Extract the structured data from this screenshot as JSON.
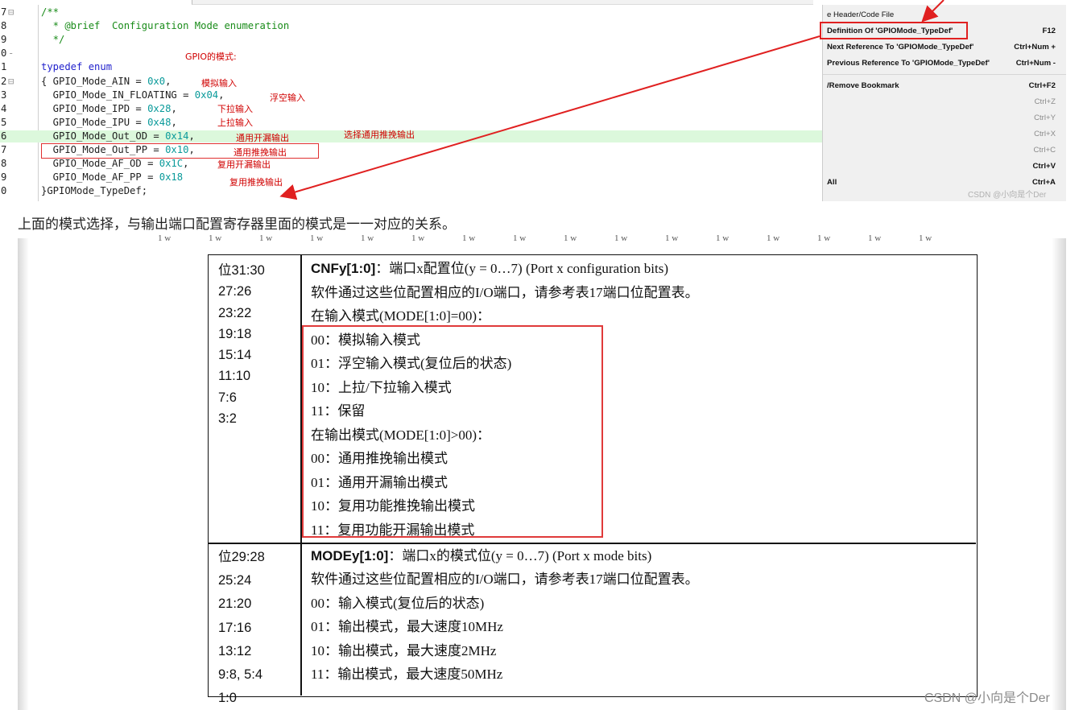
{
  "editor": {
    "lines": [
      {
        "n": "7",
        "fold": "⊟",
        "code": [
          [
            "cm",
            "/**"
          ]
        ]
      },
      {
        "n": "8",
        "fold": "",
        "code": [
          [
            "cm",
            "  * @brief  Configuration Mode enumeration"
          ]
        ]
      },
      {
        "n": "9",
        "fold": "",
        "code": [
          [
            "cm",
            "  */"
          ]
        ]
      },
      {
        "n": "0",
        "fold": "-",
        "code": [
          [
            "plain",
            ""
          ]
        ]
      },
      {
        "n": "1",
        "fold": "",
        "code": [
          [
            "kw",
            "typedef enum"
          ]
        ]
      },
      {
        "n": "2",
        "fold": "⊟",
        "code": [
          [
            "plain",
            "{ GPIO_Mode_AIN = "
          ],
          [
            "num",
            "0x0"
          ],
          [
            "plain",
            ","
          ]
        ]
      },
      {
        "n": "3",
        "fold": "",
        "code": [
          [
            "plain",
            "  GPIO_Mode_IN_FLOATING = "
          ],
          [
            "num",
            "0x04"
          ],
          [
            "plain",
            ","
          ]
        ]
      },
      {
        "n": "4",
        "fold": "",
        "code": [
          [
            "plain",
            "  GPIO_Mode_IPD = "
          ],
          [
            "num",
            "0x28"
          ],
          [
            "plain",
            ","
          ]
        ]
      },
      {
        "n": "5",
        "fold": "",
        "code": [
          [
            "plain",
            "  GPIO_Mode_IPU = "
          ],
          [
            "num",
            "0x48"
          ],
          [
            "plain",
            ","
          ]
        ]
      },
      {
        "n": "6",
        "fold": "",
        "code": [
          [
            "plain",
            "  GPIO_Mode_Out_OD = "
          ],
          [
            "num",
            "0x14"
          ],
          [
            "plain",
            ","
          ]
        ]
      },
      {
        "n": "7",
        "fold": "",
        "code": [
          [
            "plain",
            "  GPIO_Mode_Out_PP = "
          ],
          [
            "num",
            "0x10"
          ],
          [
            "plain",
            ","
          ]
        ]
      },
      {
        "n": "8",
        "fold": "",
        "code": [
          [
            "plain",
            "  GPIO_Mode_AF_OD = "
          ],
          [
            "num",
            "0x1C"
          ],
          [
            "plain",
            ","
          ]
        ]
      },
      {
        "n": "9",
        "fold": "",
        "code": [
          [
            "plain",
            "  GPIO_Mode_AF_PP = "
          ],
          [
            "num",
            "0x18"
          ]
        ]
      },
      {
        "n": "0",
        "fold": "",
        "code": [
          [
            "plain",
            "}GPIOMode_TypeDef;"
          ]
        ]
      }
    ],
    "annotations": {
      "gpio_mode": "GPIO的模式:",
      "ain": "模拟输入",
      "floating": "浮空输入",
      "ipd": "下拉输入",
      "ipu": "上拉输入",
      "out_od": "通用开漏输出",
      "select": "选择通用推挽输出",
      "out_pp": "通用推挽输出",
      "af_od": "复用开漏输出",
      "af_pp": "复用推挽输出"
    }
  },
  "context_menu": {
    "items": [
      {
        "label": "e Header/Code File",
        "shortcut": "",
        "disabled": false,
        "bold": false
      },
      {
        "label": "Definition Of 'GPIOMode_TypeDef'",
        "shortcut": "F12",
        "disabled": false,
        "bold": true
      },
      {
        "label": "Next Reference To 'GPIOMode_TypeDef'",
        "shortcut": "Ctrl+Num +",
        "disabled": false,
        "bold": true
      },
      {
        "label": "Previous Reference To 'GPIOMode_TypeDef'",
        "shortcut": "Ctrl+Num -",
        "disabled": false,
        "bold": true
      },
      {
        "label": "/Remove Bookmark",
        "shortcut": "Ctrl+F2",
        "disabled": false,
        "bold": true
      },
      {
        "label": "",
        "shortcut": "Ctrl+Z",
        "disabled": true,
        "bold": false
      },
      {
        "label": "",
        "shortcut": "Ctrl+Y",
        "disabled": true,
        "bold": false
      },
      {
        "label": "",
        "shortcut": "Ctrl+X",
        "disabled": true,
        "bold": false
      },
      {
        "label": "",
        "shortcut": "Ctrl+C",
        "disabled": true,
        "bold": false
      },
      {
        "label": "",
        "shortcut": "Ctrl+V",
        "disabled": false,
        "bold": true
      },
      {
        "label": "All",
        "shortcut": "Ctrl+A",
        "disabled": false,
        "bold": true
      }
    ],
    "watermark": "CSDN @小向是个Der"
  },
  "article": {
    "text": "上面的模式选择，与输出端口配置寄存器里面的模式是一一对应的关系。"
  },
  "doc": {
    "tick_marks": [
      "1 w",
      "1 w",
      "1 w",
      "1 w",
      "1 w",
      "1 w",
      "1 w",
      "1 w",
      "1 w",
      "1 w",
      "1 w",
      "1 w",
      "1 w",
      "1 w",
      "1 w",
      "1 w"
    ],
    "cnf": {
      "bits": [
        "位31:30",
        "27:26",
        "23:22",
        "19:18",
        "15:14",
        "11:10",
        "7:6",
        "3:2"
      ],
      "title_bold": "CNFy[1:0]",
      "title_rest": "：端口x配置位(y = 0…7) (Port x configuration bits)",
      "lines": [
        "软件通过这些位配置相应的I/O端口，请参考表17端口位配置表。",
        "在输入模式(MODE[1:0]=00)：",
        "00：模拟输入模式",
        "01：浮空输入模式(复位后的状态)",
        "10：上拉/下拉输入模式",
        "11：保留",
        "在输出模式(MODE[1:0]>00)：",
        "00：通用推挽输出模式",
        "01：通用开漏输出模式",
        "10：复用功能推挽输出模式",
        "11：复用功能开漏输出模式"
      ]
    },
    "mode": {
      "bits": [
        "位29:28",
        "25:24",
        "21:20",
        "17:16",
        "13:12",
        "9:8, 5:4",
        "1:0"
      ],
      "title_bold": "MODEy[1:0]",
      "title_rest": "：端口x的模式位(y = 0…7) (Port x mode bits)",
      "lines": [
        "软件通过这些位配置相应的I/O端口，请参考表17端口位配置表。",
        "00：输入模式(复位后的状态)",
        "01：输出模式，最大速度10MHz",
        "10：输出模式，最大速度2MHz",
        "11：输出模式，最大速度50MHz"
      ]
    },
    "watermark": "CSDN @小向是个Der"
  },
  "colors": {
    "annotation": "#d00000",
    "highlight": "#dcf8dc",
    "box": "#e03030"
  }
}
